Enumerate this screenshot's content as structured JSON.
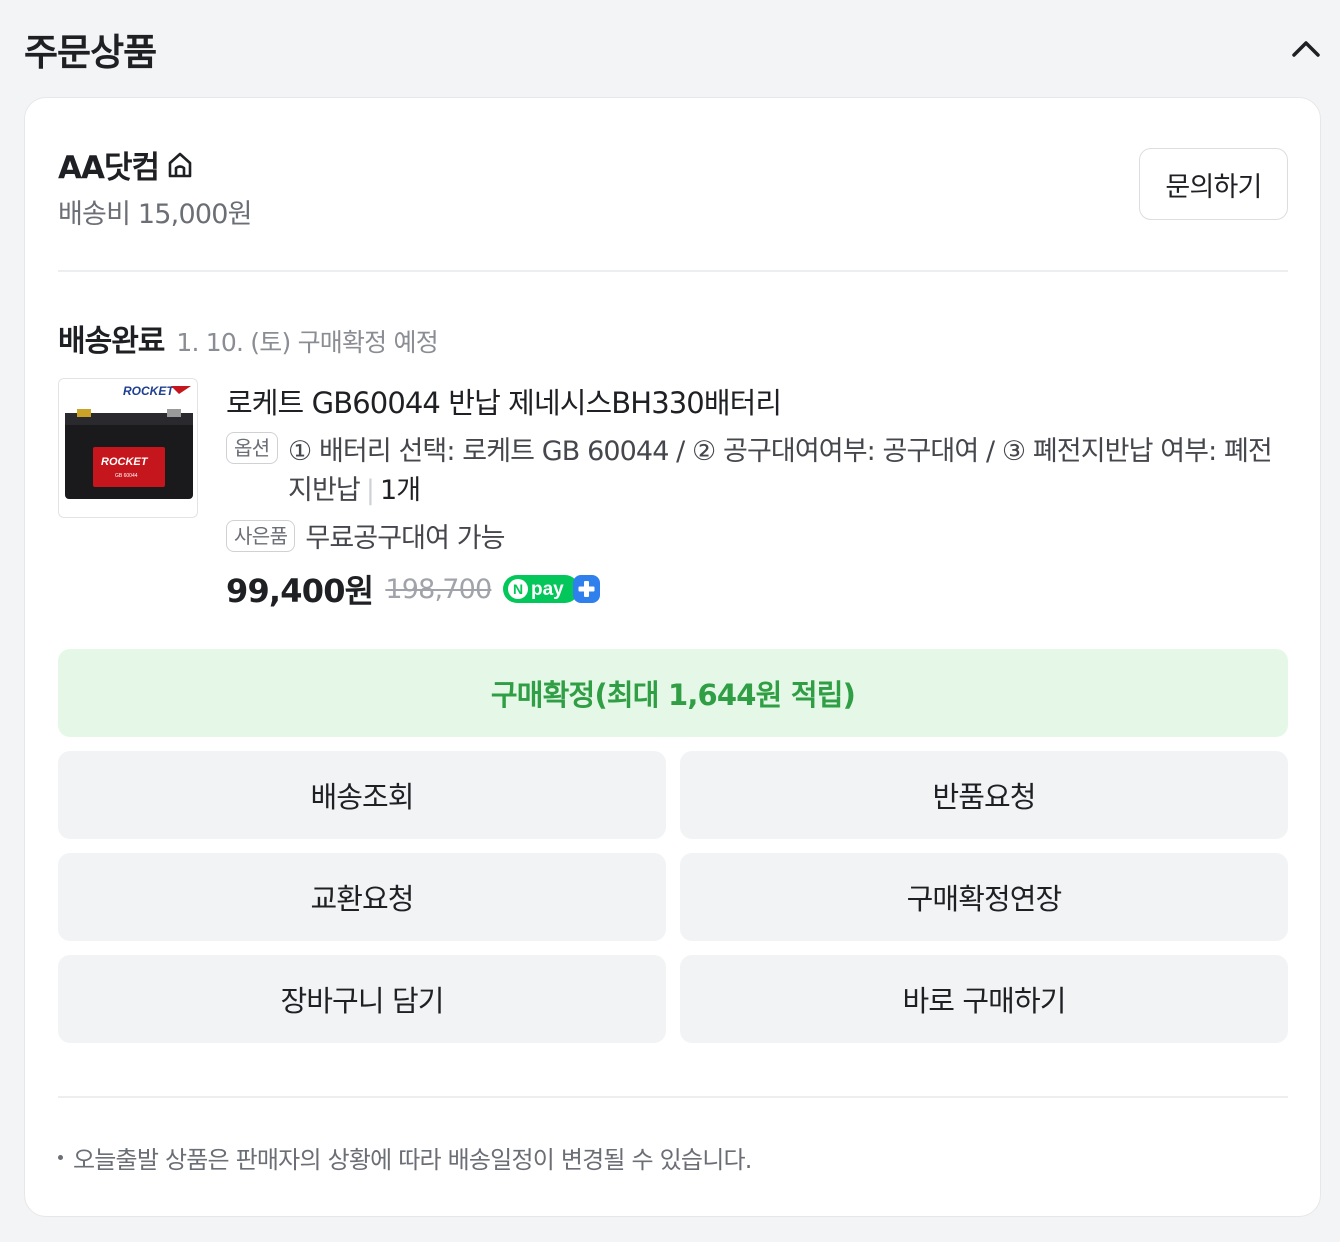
{
  "section": {
    "title": "주문상품",
    "collapse_icon": "chevron-up-icon"
  },
  "seller": {
    "name": "AA닷컴",
    "home_icon": "home-icon",
    "shipping_fee": "배송비 15,000원",
    "inquiry_label": "문의하기"
  },
  "delivery": {
    "status": "배송완료",
    "detail": "1. 10. (토) 구매확정 예정"
  },
  "product": {
    "image_brand_text": "ROCKET",
    "image_model_text": "GB 60044",
    "name": "로케트 GB60044 반납 제네시스BH330배터리",
    "option_tag": "옵션",
    "options": "① 배터리 선택: 로케트 GB 60044 / ② 공구대여여부: 공구대여 / ③ 폐전지반납 여부: 폐전지반납",
    "separator": "|",
    "quantity": "1개",
    "gift_tag": "사은품",
    "gift_text": "무료공구대여 가능",
    "price": "99,400원",
    "original_price": "198,700",
    "npay_label": "pay",
    "npay_n": "N",
    "npay_plus_icon": "plus-icon"
  },
  "actions": {
    "confirm_label": "구매확정(최대 1,644원 적립)",
    "track_label": "배송조회",
    "return_label": "반품요청",
    "exchange_label": "교환요청",
    "extend_label": "구매확정연장",
    "cart_label": "장바구니 담기",
    "buy_label": "바로 구매하기"
  },
  "notice": {
    "text": "오늘출발 상품은 판매자의 상황에 따라 배송일정이 변경될 수 있습니다."
  },
  "colors": {
    "confirm_bg": "#e5f8e7",
    "confirm_text": "#2f9e44",
    "npay_green": "#03c75a",
    "npay_blue": "#2f80ed",
    "battery_red": "#c4161c"
  }
}
